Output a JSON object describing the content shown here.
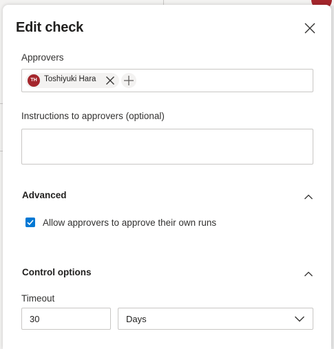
{
  "dialog": {
    "title": "Edit check",
    "close_icon": "close-icon"
  },
  "approvers": {
    "label": "Approvers",
    "items": [
      {
        "initials": "TH",
        "name": "Toshiyuki Hara",
        "avatar_color": "#a4262c"
      }
    ],
    "remove_icon": "close-icon",
    "add_icon": "plus-icon"
  },
  "instructions": {
    "label": "Instructions to approvers (optional)",
    "value": ""
  },
  "advanced": {
    "title": "Advanced",
    "expanded": true,
    "allow_self_approve": {
      "label": "Allow approvers to approve their own runs",
      "checked": true
    }
  },
  "control_options": {
    "title": "Control options",
    "expanded": true,
    "timeout": {
      "label": "Timeout",
      "value": "30",
      "unit": "Days"
    }
  },
  "colors": {
    "accent": "#0078d4",
    "avatar": "#a4262c"
  }
}
